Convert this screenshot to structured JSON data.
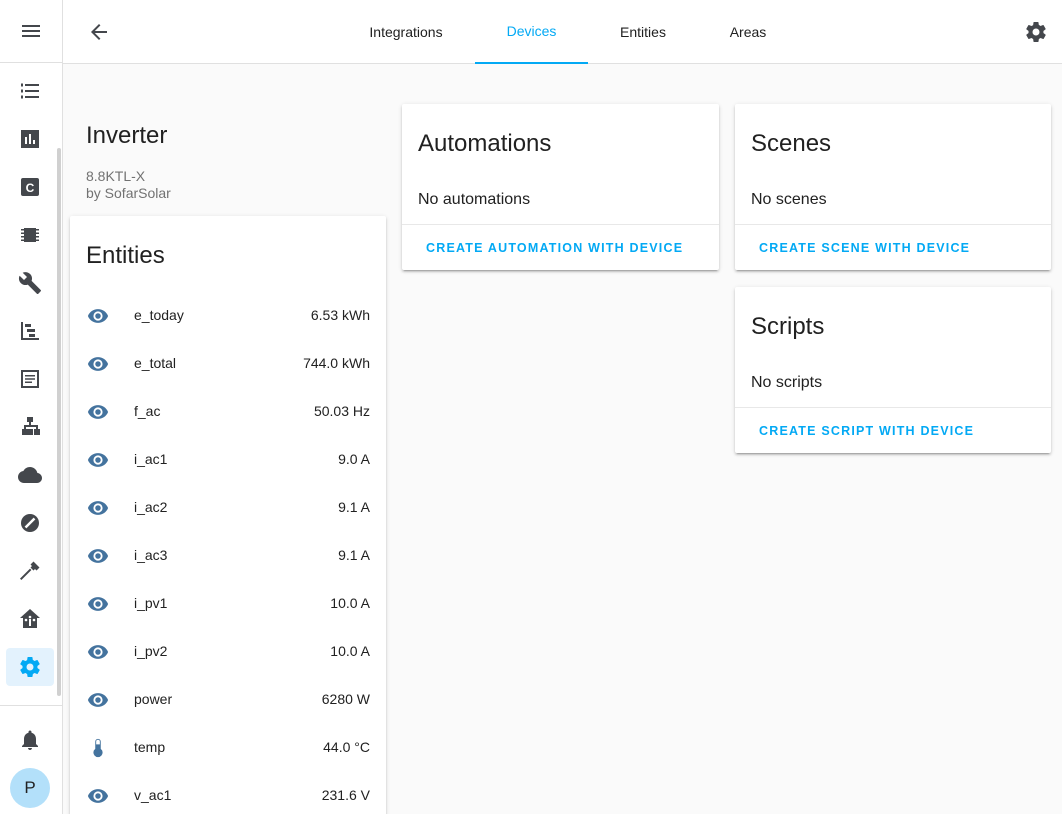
{
  "tabs": [
    {
      "label": "Integrations",
      "active": false
    },
    {
      "label": "Devices",
      "active": true
    },
    {
      "label": "Entities",
      "active": false
    },
    {
      "label": "Areas",
      "active": false
    }
  ],
  "sidebar": {
    "items": [
      {
        "icon": "list-icon"
      },
      {
        "icon": "chart-icon"
      },
      {
        "icon": "c-box-icon"
      },
      {
        "icon": "chip-icon"
      },
      {
        "icon": "wrench-icon"
      },
      {
        "icon": "gantt-icon"
      },
      {
        "icon": "text-box-icon"
      },
      {
        "icon": "sitemap-icon"
      },
      {
        "icon": "cloud-icon"
      },
      {
        "icon": "slash-circle-icon"
      },
      {
        "icon": "hammer-icon"
      },
      {
        "icon": "home-assistant-icon"
      },
      {
        "icon": "gear-icon",
        "active": true
      }
    ],
    "avatar_letter": "P"
  },
  "device": {
    "name": "Inverter",
    "model": "8.8KTL-X",
    "manufacturer": "by SofarSolar"
  },
  "entities_card": {
    "title": "Entities",
    "rows": [
      {
        "icon": "eye-icon",
        "name": "e_today",
        "value": "6.53 kWh"
      },
      {
        "icon": "eye-icon",
        "name": "e_total",
        "value": "744.0 kWh"
      },
      {
        "icon": "eye-icon",
        "name": "f_ac",
        "value": "50.03 Hz"
      },
      {
        "icon": "eye-icon",
        "name": "i_ac1",
        "value": "9.0 A"
      },
      {
        "icon": "eye-icon",
        "name": "i_ac2",
        "value": "9.1 A"
      },
      {
        "icon": "eye-icon",
        "name": "i_ac3",
        "value": "9.1 A"
      },
      {
        "icon": "eye-icon",
        "name": "i_pv1",
        "value": "10.0 A"
      },
      {
        "icon": "eye-icon",
        "name": "i_pv2",
        "value": "10.0 A"
      },
      {
        "icon": "eye-icon",
        "name": "power",
        "value": "6280 W"
      },
      {
        "icon": "thermometer-icon",
        "name": "temp",
        "value": "44.0 °C"
      },
      {
        "icon": "eye-icon",
        "name": "v_ac1",
        "value": "231.6 V"
      }
    ]
  },
  "automations_card": {
    "title": "Automations",
    "empty_text": "No automations",
    "action": "CREATE AUTOMATION WITH DEVICE"
  },
  "scenes_card": {
    "title": "Scenes",
    "empty_text": "No scenes",
    "action": "CREATE SCENE WITH DEVICE"
  },
  "scripts_card": {
    "title": "Scripts",
    "empty_text": "No scripts",
    "action": "CREATE SCRIPT WITH DEVICE"
  },
  "colors": {
    "accent": "#03a9f4",
    "icon": "#44739e",
    "sidebar_icon": "#44474c"
  }
}
